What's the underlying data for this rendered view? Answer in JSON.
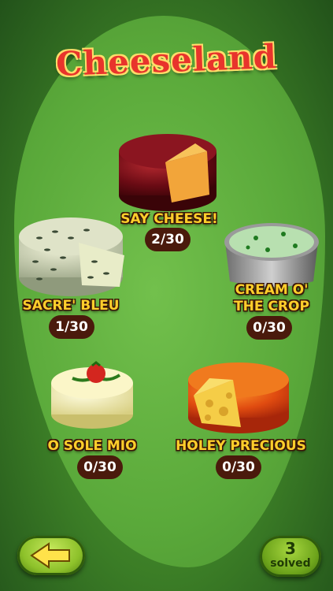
{
  "title": "Cheeseland",
  "levels": [
    {
      "name": "SAY CHEESE!",
      "progress": "2/30"
    },
    {
      "name": "SACRE' BLEU",
      "progress": "1/30"
    },
    {
      "name_line1": "CREAM O'",
      "name_line2": "THE CROP",
      "progress": "0/30"
    },
    {
      "name": "O SOLE MIO",
      "progress": "0/30"
    },
    {
      "name": "HOLEY PRECIOUS",
      "progress": "0/30"
    }
  ],
  "solved": {
    "count": "3",
    "label": "solved"
  },
  "icons": {
    "back": "arrow-left-icon"
  }
}
